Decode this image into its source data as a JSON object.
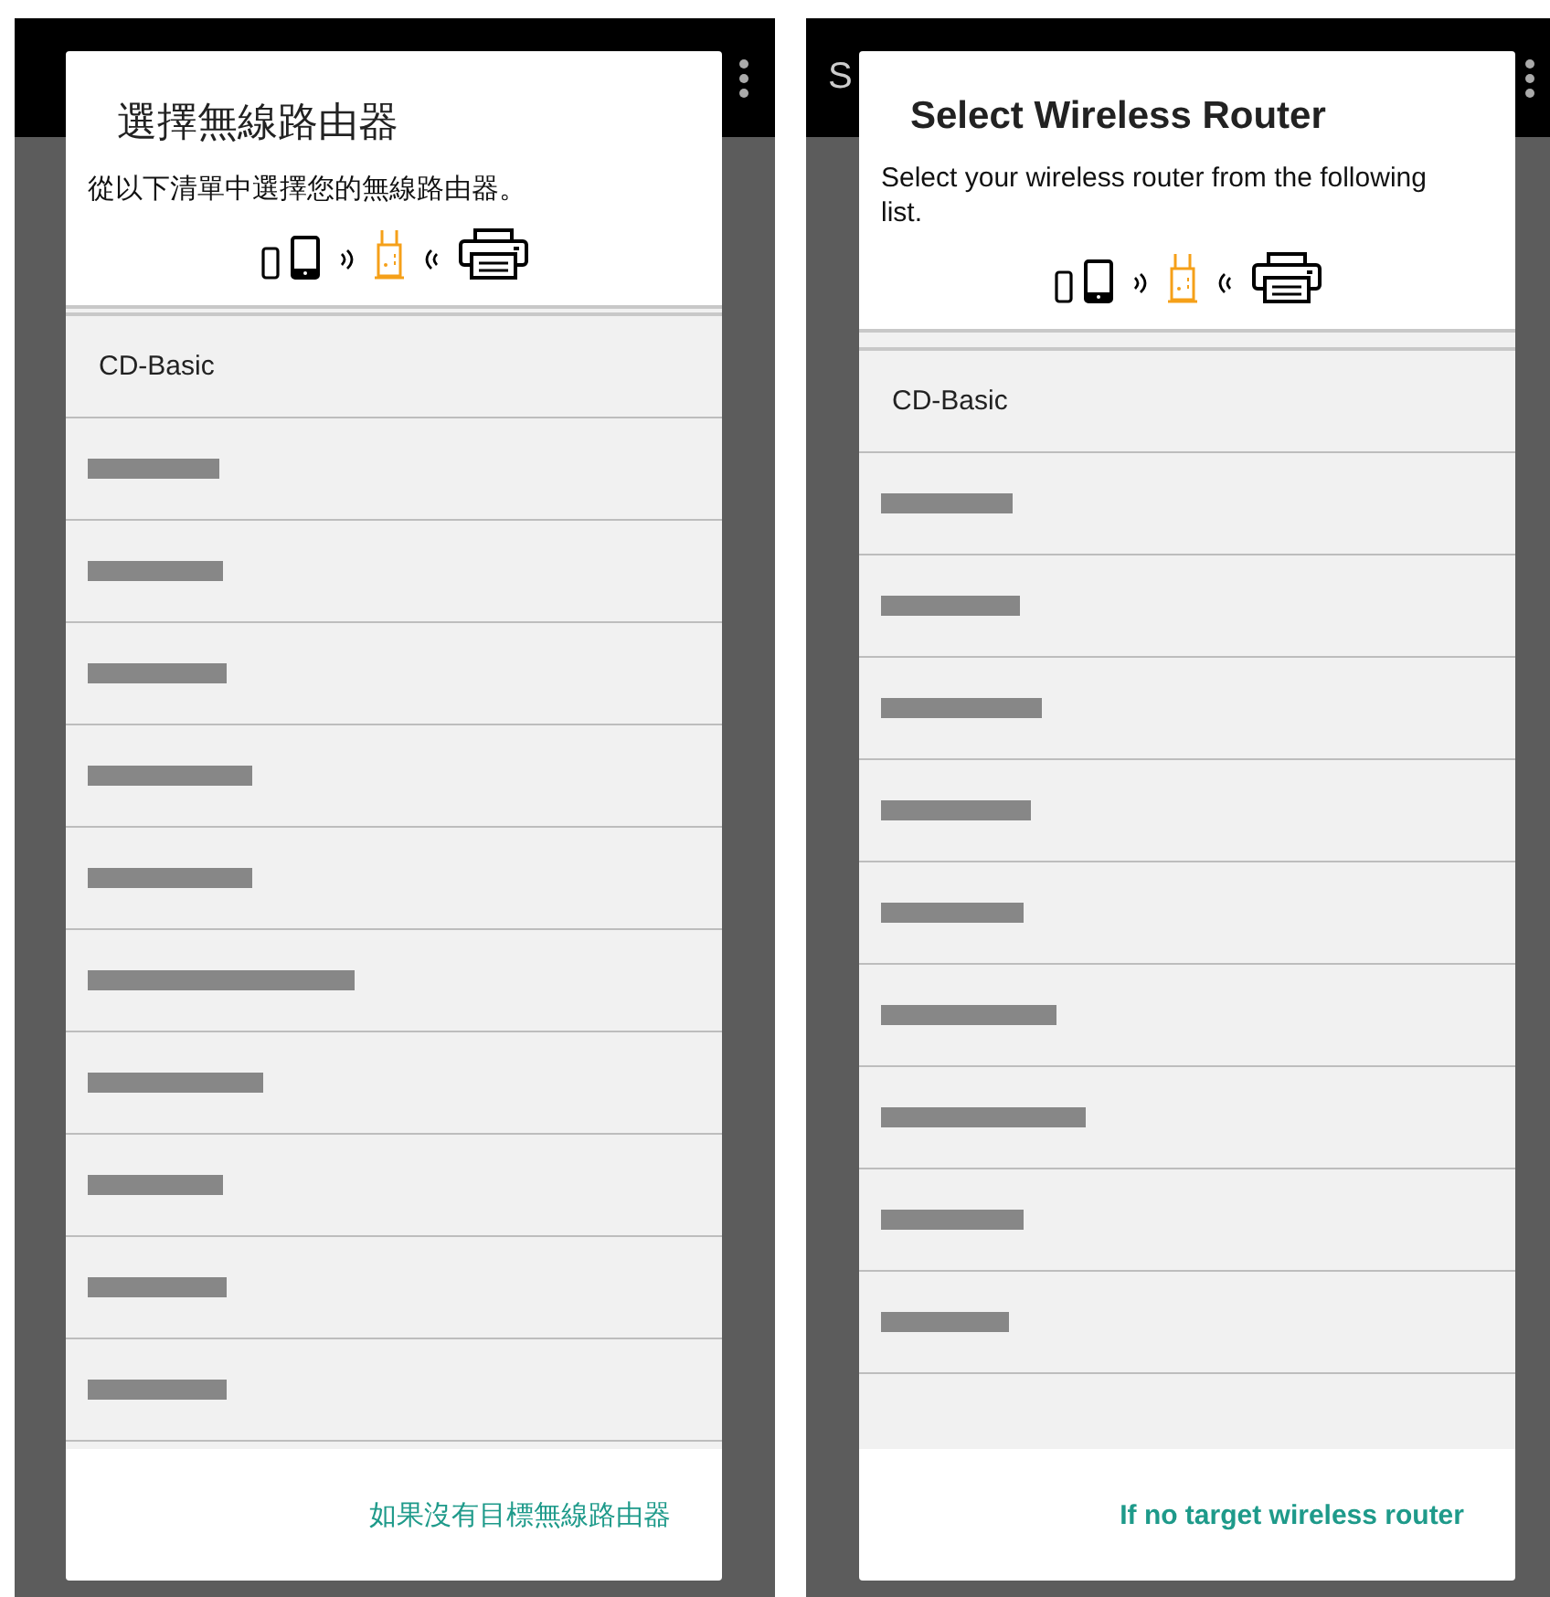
{
  "screens": [
    {
      "dialog": {
        "title": "選擇無線路由器",
        "description": "從以下清單中選擇您的無線路由器。",
        "routers": [
          {
            "kind": "name",
            "name": "CD-Basic"
          },
          {
            "kind": "redacted"
          },
          {
            "kind": "redacted"
          },
          {
            "kind": "redacted"
          },
          {
            "kind": "redacted"
          },
          {
            "kind": "redacted"
          },
          {
            "kind": "redacted"
          },
          {
            "kind": "redacted"
          },
          {
            "kind": "redacted"
          },
          {
            "kind": "redacted"
          },
          {
            "kind": "redacted"
          }
        ],
        "footer_button": "如果沒有目標無線路由器"
      }
    },
    {
      "app_bar": {
        "title": "S"
      },
      "dialog": {
        "title": "Select Wireless Router",
        "description": "Select your wireless router from the following list.",
        "routers": [
          {
            "kind": "name",
            "name": "CD-Basic"
          },
          {
            "kind": "redacted"
          },
          {
            "kind": "redacted"
          },
          {
            "kind": "redacted"
          },
          {
            "kind": "redacted"
          },
          {
            "kind": "redacted"
          },
          {
            "kind": "redacted"
          },
          {
            "kind": "redacted"
          },
          {
            "kind": "redacted"
          },
          {
            "kind": "redacted"
          },
          {
            "kind": "empty"
          }
        ],
        "footer_button": "If no target wireless router"
      }
    }
  ]
}
